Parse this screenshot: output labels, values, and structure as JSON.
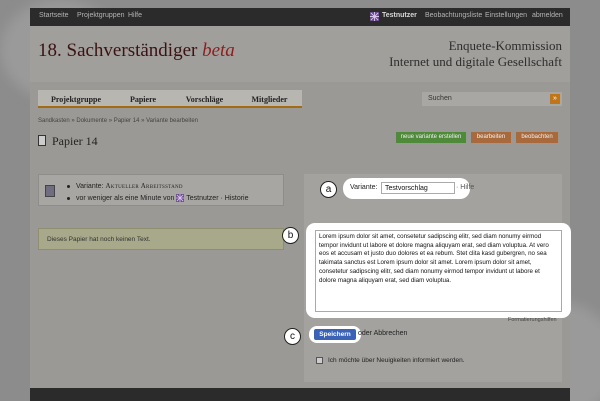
{
  "topbar": {
    "left_links": [
      "Startseite",
      "Projektgruppen",
      "Hilfe"
    ],
    "user": "Testnutzer",
    "right_links": [
      "Beobachtungsliste",
      "Einstellungen",
      "abmelden"
    ]
  },
  "header": {
    "logo_main": "18. Sachverständiger",
    "logo_beta": "beta",
    "enquete_line1": "Enquete-Kommission",
    "enquete_line2": "Internet und digitale Gesellschaft"
  },
  "nav": {
    "tabs": [
      "Projektgruppe",
      "Papiere",
      "Vorschläge",
      "Mitglieder"
    ],
    "search_label": "Suchen",
    "search_button": "»"
  },
  "breadcrumb": "Sandkasten » Dokumente » Papier 14 » Variante bearbeiten",
  "page_title": "Papier 14",
  "actions": {
    "new_variant": "neue variante erstellen",
    "edit": "bearbeiten",
    "delete": "beobachten"
  },
  "info": {
    "variant_prefix": "Variante:",
    "variant_name": "Aktueller Arbeitsstand",
    "time_text": "vor weniger als eine Minute von",
    "user": "Testnutzer",
    "history": "Historie"
  },
  "no_text_notice": "Dieses Papier hat noch keinen Text.",
  "form": {
    "variant_label": "Variante:",
    "variant_value": "Testvorschlag",
    "help": "· Hilfe",
    "body": "Lorem ipsum dolor sit amet, consetetur sadipscing elitr, sed diam nonumy eirmod tempor invidunt ut labore et dolore magna aliquyam erat, sed diam voluptua. At vero eos et accusam et justo duo dolores et ea rebum. Stet clita kasd gubergren, no sea takimata sanctus est Lorem ipsum dolor sit amet. Lorem ipsum dolor sit amet, consetetur sadipscing elitr, sed diam nonumy eirmod tempor invidunt ut labore et dolore magna aliquyam erat, sed diam voluptua.",
    "format_help": "Formatierungshilfen",
    "save": "Speichern",
    "or_cancel": "oder Abbrechen",
    "notify_label": "Ich möchte über Neuigkeiten informiert werden."
  },
  "callouts": [
    "a",
    "b",
    "c"
  ],
  "colors": {
    "nav_underline": "#a36b14",
    "new_variant_button": "#4f8a3a",
    "edit_button": "#a86a3c",
    "save_button": "#3a63b8",
    "notice_bg": "#a8a88a"
  }
}
